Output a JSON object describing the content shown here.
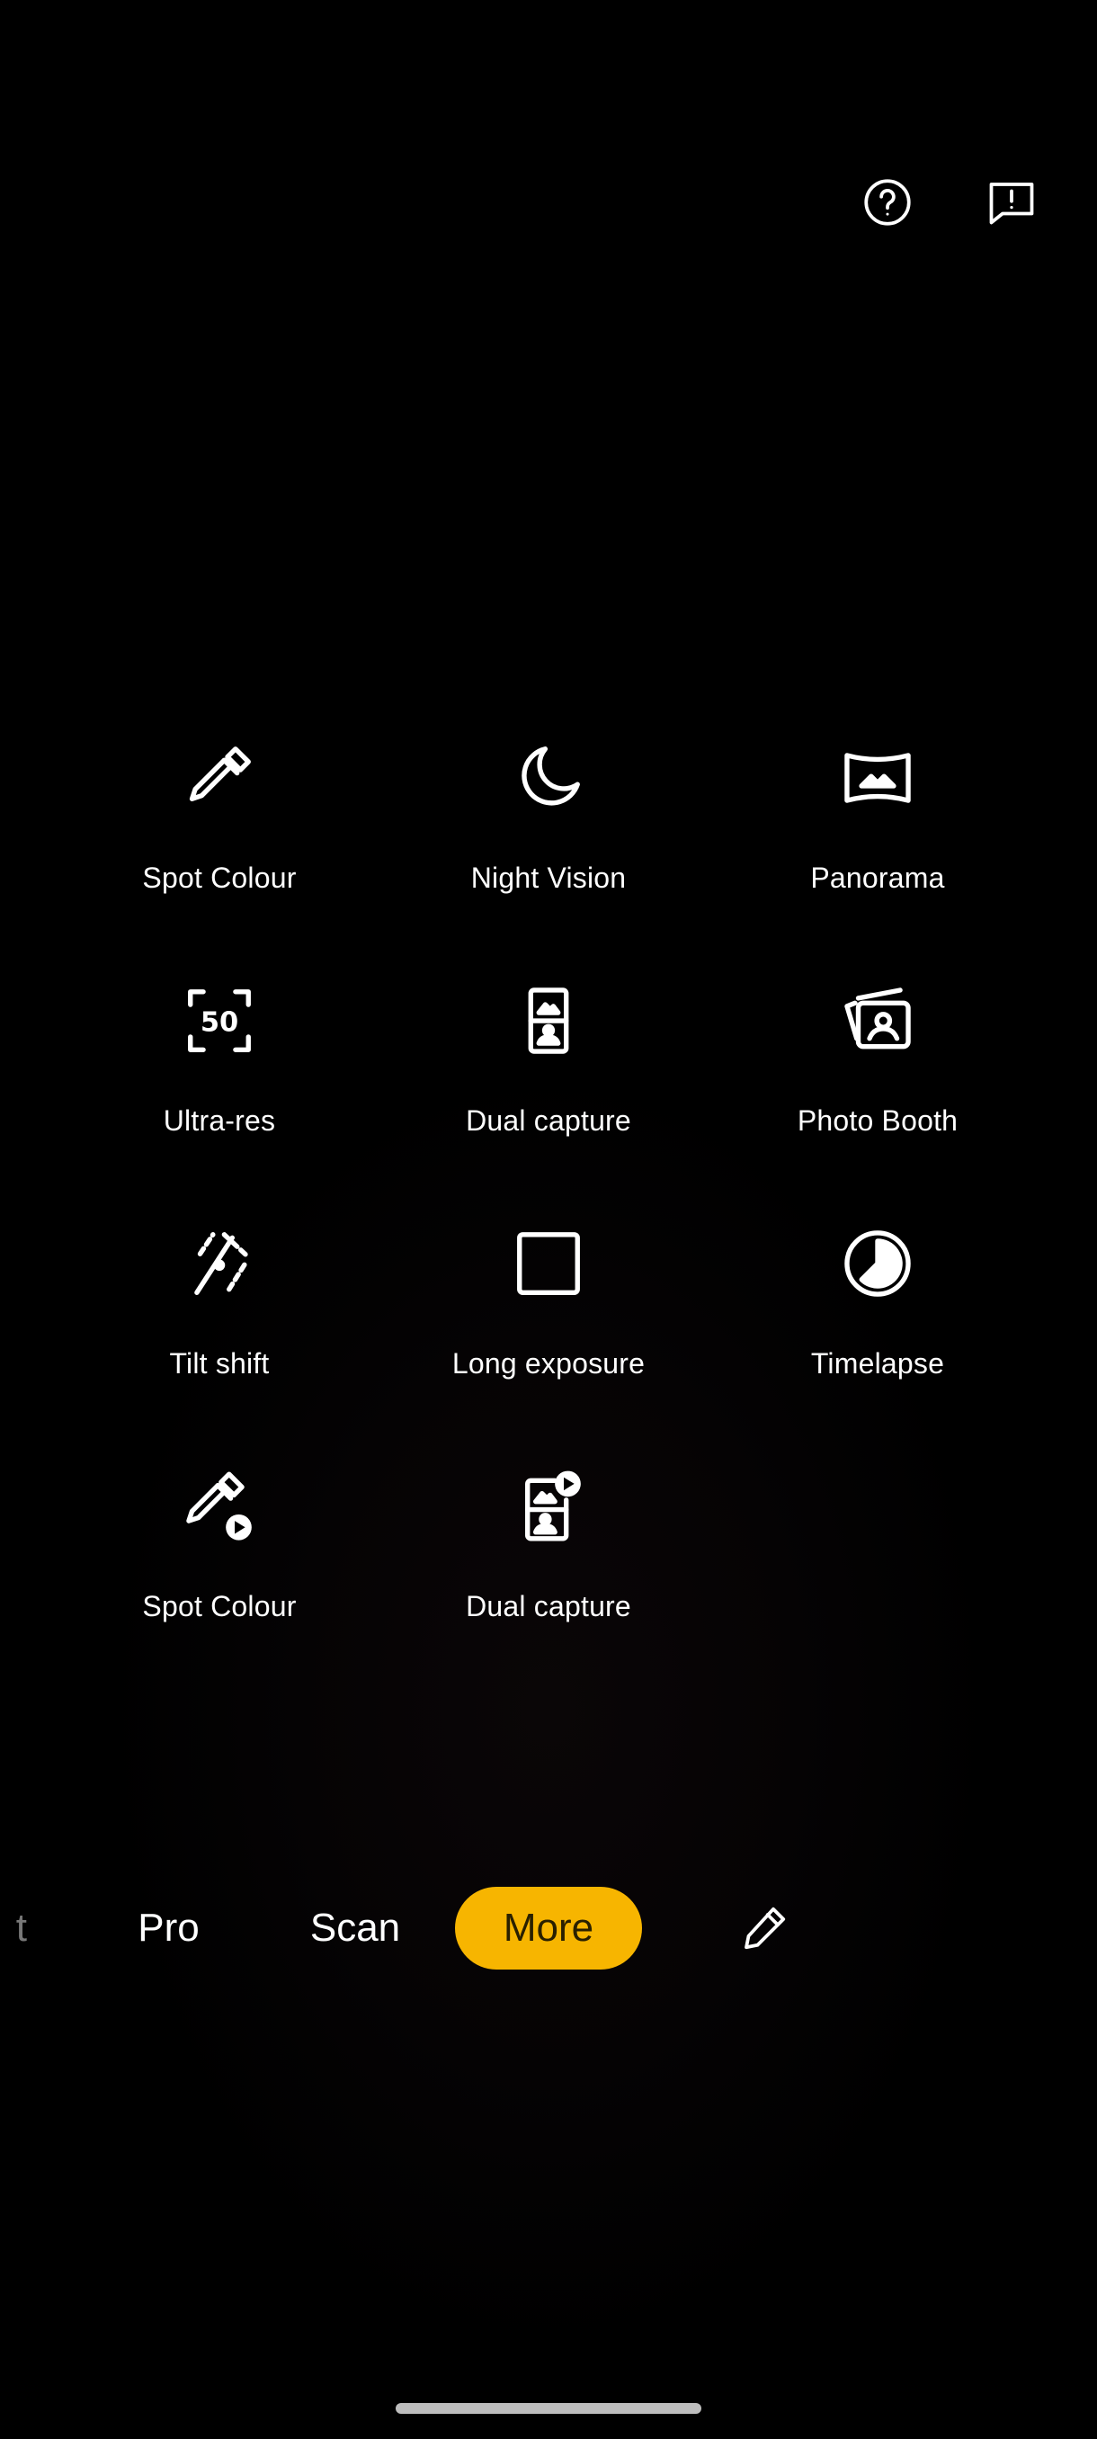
{
  "header": {
    "help_icon": "help-circle-icon",
    "feedback_icon": "feedback-icon"
  },
  "modes": [
    {
      "label": "Spot Colour",
      "icon": "eyedropper-icon"
    },
    {
      "label": "Night Vision",
      "icon": "moon-icon"
    },
    {
      "label": "Panorama",
      "icon": "panorama-icon"
    },
    {
      "label": "Ultra-res",
      "icon": "ultra-res-50-icon",
      "icon_text": "50"
    },
    {
      "label": "Dual capture",
      "icon": "dual-capture-icon"
    },
    {
      "label": "Photo Booth",
      "icon": "photo-booth-icon"
    },
    {
      "label": "Tilt shift",
      "icon": "tilt-shift-icon"
    },
    {
      "label": "Long exposure",
      "icon": "long-exposure-icon"
    },
    {
      "label": "Timelapse",
      "icon": "timelapse-icon"
    },
    {
      "label": "Spot Colour",
      "icon": "eyedropper-video-icon"
    },
    {
      "label": "Dual capture",
      "icon": "dual-capture-video-icon"
    }
  ],
  "mode_bar": {
    "partial": "t",
    "pro": "Pro",
    "scan": "Scan",
    "more": "More",
    "edit_icon": "pencil-icon"
  },
  "colors": {
    "accent": "#f7b500",
    "background": "#000000",
    "text": "#ffffff"
  }
}
